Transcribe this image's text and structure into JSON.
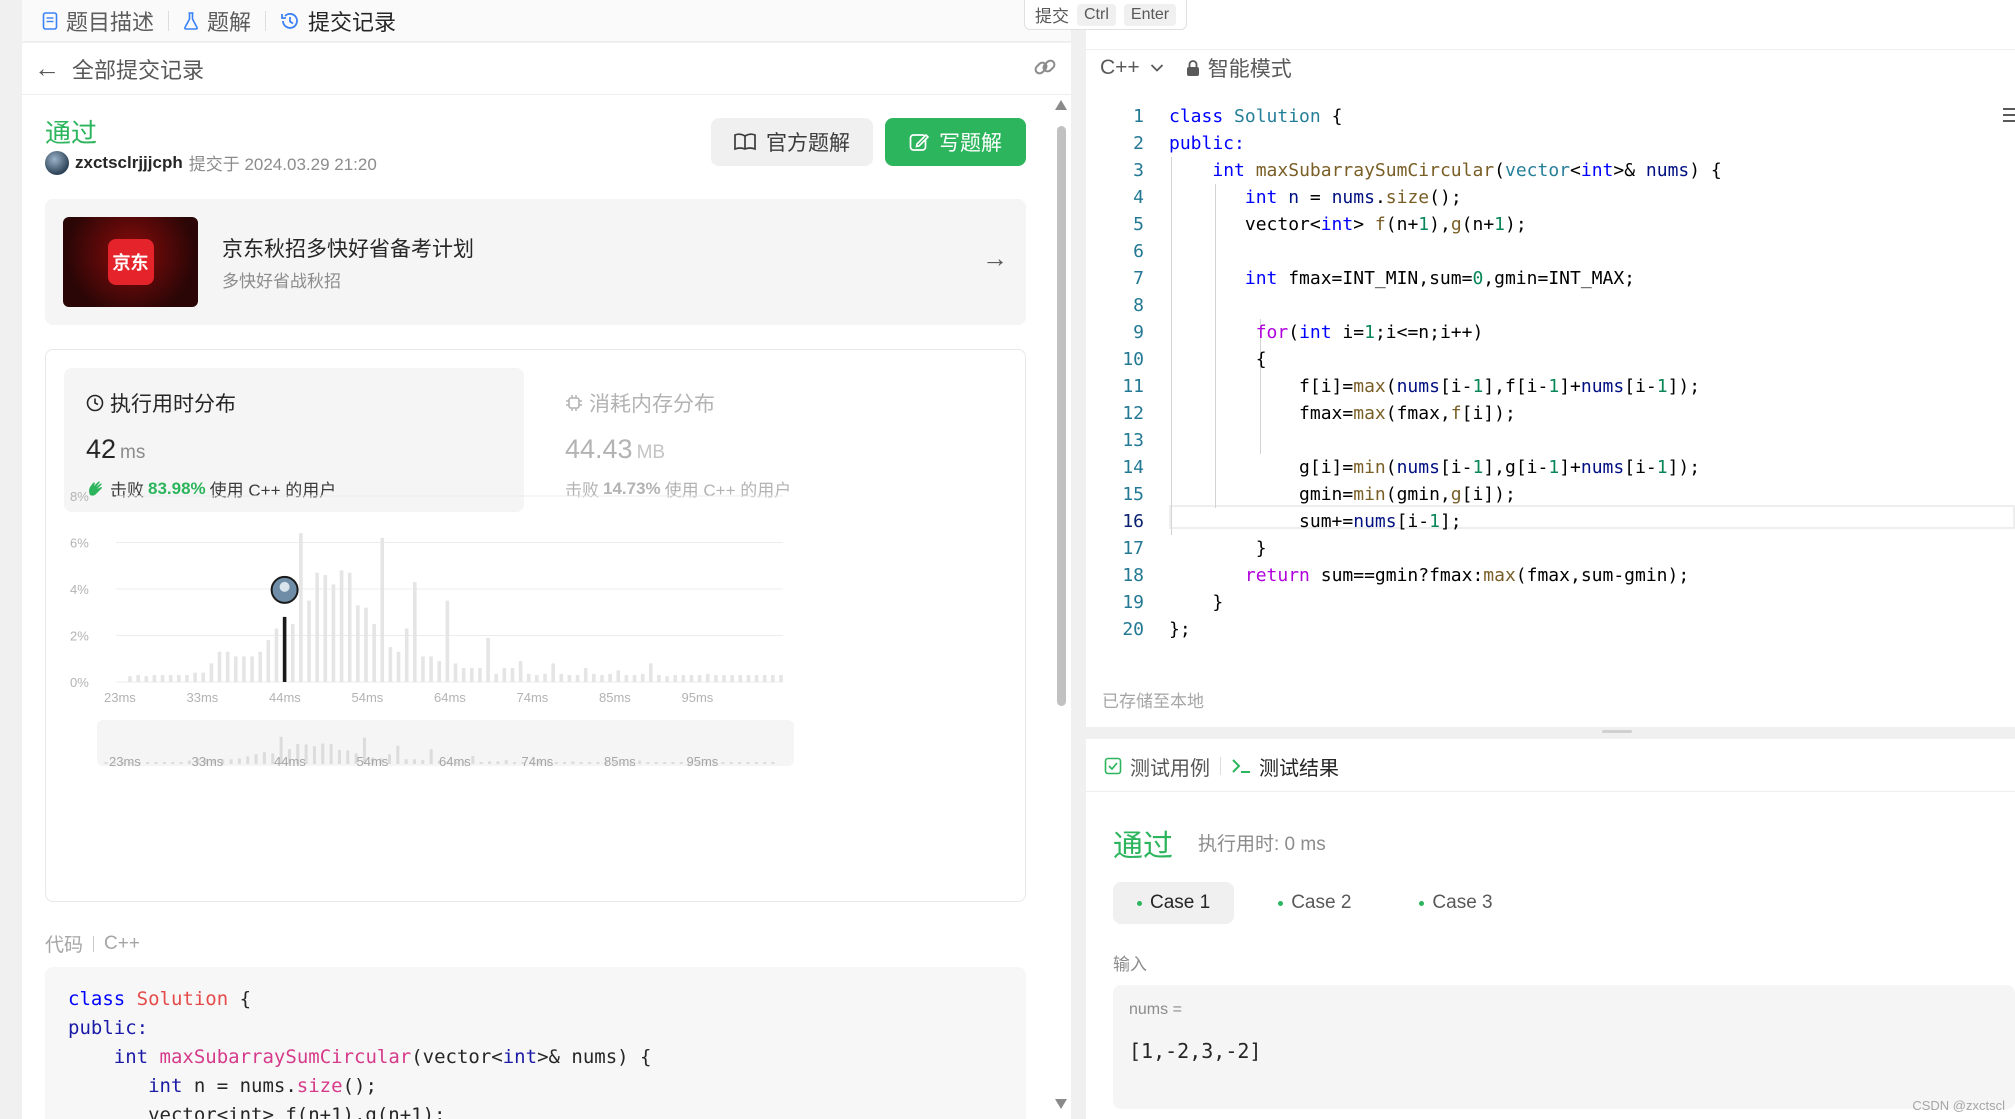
{
  "left_tabs": [
    {
      "label": "题目描述",
      "icon": "document-icon"
    },
    {
      "label": "题解",
      "icon": "flask-icon"
    },
    {
      "label": "提交记录",
      "icon": "history-icon"
    }
  ],
  "submissions": {
    "back_label": "全部提交记录",
    "status": "通过",
    "user": "zxctsclrjjjcph",
    "submitted_at": "提交于 2024.03.29 21:20",
    "official_solution_label": "官方题解",
    "write_solution_label": "写题解"
  },
  "ad": {
    "logo_text": "京东",
    "title": "京东秋招多快好省备考计划",
    "subtitle": "多快好省战秋招"
  },
  "perf": {
    "runtime": {
      "title": "执行用时分布",
      "value": "42",
      "unit": "ms",
      "beat_prefix": "击败",
      "beat_pct": "83.98%",
      "beat_suffix": "使用 C++ 的用户"
    },
    "memory": {
      "title": "消耗内存分布",
      "value": "44.43",
      "unit": "MB",
      "beat_prefix": "击败",
      "beat_pct": "14.73%",
      "beat_suffix": "使用 C++ 的用户"
    }
  },
  "chart_data": {
    "type": "bar",
    "title": "",
    "xlabel": "",
    "ylabel": "",
    "ylim": [
      0,
      8
    ],
    "y_ticks": [
      "0%",
      "2%",
      "4%",
      "6%",
      "8%"
    ],
    "x_tick_labels": [
      "23ms",
      "33ms",
      "44ms",
      "54ms",
      "64ms",
      "74ms",
      "85ms",
      "95ms"
    ],
    "x_start_ms": 23,
    "x_step_ms": 1,
    "highlight_ms": 42,
    "values": [
      0.25,
      0.3,
      0.25,
      0.3,
      0.3,
      0.3,
      0.3,
      0.3,
      0.4,
      0.4,
      0.8,
      1.3,
      1.3,
      1.1,
      1.1,
      1.1,
      1.3,
      1.8,
      2.3,
      2.8,
      2.5,
      6.4,
      3.5,
      4.7,
      4.6,
      4.2,
      4.8,
      4.7,
      3.3,
      3.2,
      2.5,
      6.2,
      1.5,
      1.3,
      2.3,
      4.3,
      1.1,
      1.1,
      0.9,
      3.5,
      0.8,
      0.6,
      0.6,
      0.6,
      1.9,
      0.35,
      0.6,
      0.6,
      0.9,
      0.35,
      0.3,
      0.35,
      0.8,
      0.35,
      0.3,
      0.3,
      0.6,
      0.35,
      0.3,
      0.35,
      0.5,
      0.3,
      0.3,
      0.35,
      0.8,
      0.3,
      0.25,
      0.3,
      0.3,
      0.3,
      0.3,
      0.35,
      0.3,
      0.3,
      0.3,
      0.3,
      0.3,
      0.3,
      0.3,
      0.3,
      0.3
    ]
  },
  "code_section": {
    "label": "代码",
    "lang": "C++",
    "lines": [
      [
        {
          "t": "class",
          "c": "kw"
        },
        {
          "t": " "
        },
        {
          "t": "Solution",
          "c": "cls"
        },
        {
          "t": " {"
        }
      ],
      [
        {
          "t": "public:",
          "c": "kwb"
        }
      ],
      [
        {
          "t": "    "
        },
        {
          "t": "int",
          "c": "kwb"
        },
        {
          "t": " "
        },
        {
          "t": "maxSubarraySumCircular",
          "c": "fn"
        },
        {
          "t": "(vector<"
        },
        {
          "t": "int",
          "c": "kwb"
        },
        {
          "t": ">& nums) {"
        }
      ],
      [
        {
          "t": "       "
        },
        {
          "t": "int",
          "c": "kwb"
        },
        {
          "t": " n = nums."
        },
        {
          "t": "size",
          "c": "fn"
        },
        {
          "t": "();"
        }
      ],
      [
        {
          "t": "       vector<int> f(n+1),g(n+1);"
        }
      ]
    ]
  },
  "editor": {
    "submit_label": "提交",
    "key1": "Ctrl",
    "key2": "Enter",
    "language": "C++",
    "mode": "智能模式",
    "saved_text": "已存储至本地",
    "current_line": 16,
    "lines": [
      [
        {
          "t": "class ",
          "c": "c-kw"
        },
        {
          "t": "Solution",
          "c": "c-ty"
        },
        {
          "t": " {"
        }
      ],
      [
        {
          "t": "public:",
          "c": "c-kw"
        }
      ],
      [
        {
          "t": "    "
        },
        {
          "t": "int",
          "c": "c-kw"
        },
        {
          "t": " "
        },
        {
          "t": "maxSubarraySumCircular",
          "c": "c-fn"
        },
        {
          "t": "("
        },
        {
          "t": "vector",
          "c": "c-ty"
        },
        {
          "t": "<"
        },
        {
          "t": "int",
          "c": "c-kw"
        },
        {
          "t": ">& "
        },
        {
          "t": "nums",
          "c": "c-var"
        },
        {
          "t": ") {"
        }
      ],
      [
        {
          "t": "       "
        },
        {
          "t": "int",
          "c": "c-kw"
        },
        {
          "t": " "
        },
        {
          "t": "n",
          "c": "c-var"
        },
        {
          "t": " = "
        },
        {
          "t": "nums",
          "c": "c-var"
        },
        {
          "t": "."
        },
        {
          "t": "size",
          "c": "c-fn"
        },
        {
          "t": "();"
        }
      ],
      [
        {
          "t": "       vector<"
        },
        {
          "t": "int",
          "c": "c-kw"
        },
        {
          "t": "> "
        },
        {
          "t": "f",
          "c": "c-fn"
        },
        {
          "t": "(n+"
        },
        {
          "t": "1",
          "c": "c-num"
        },
        {
          "t": "),"
        },
        {
          "t": "g",
          "c": "c-fn"
        },
        {
          "t": "(n+"
        },
        {
          "t": "1",
          "c": "c-num"
        },
        {
          "t": ");"
        }
      ],
      [],
      [
        {
          "t": "       "
        },
        {
          "t": "int",
          "c": "c-kw"
        },
        {
          "t": " fmax=INT_MIN,sum="
        },
        {
          "t": "0",
          "c": "c-num"
        },
        {
          "t": ",gmin=INT_MAX;"
        }
      ],
      [],
      [
        {
          "t": "        "
        },
        {
          "t": "for",
          "c": "c-kw2"
        },
        {
          "t": "("
        },
        {
          "t": "int",
          "c": "c-kw"
        },
        {
          "t": " i="
        },
        {
          "t": "1",
          "c": "c-num"
        },
        {
          "t": ";i<=n;i++)"
        }
      ],
      [
        {
          "t": "        {"
        }
      ],
      [
        {
          "t": "            f[i]="
        },
        {
          "t": "max",
          "c": "c-fn"
        },
        {
          "t": "("
        },
        {
          "t": "nums",
          "c": "c-var"
        },
        {
          "t": "[i-"
        },
        {
          "t": "1",
          "c": "c-num"
        },
        {
          "t": "],f[i-"
        },
        {
          "t": "1",
          "c": "c-num"
        },
        {
          "t": "]+"
        },
        {
          "t": "nums",
          "c": "c-var"
        },
        {
          "t": "[i-"
        },
        {
          "t": "1",
          "c": "c-num"
        },
        {
          "t": "]);"
        }
      ],
      [
        {
          "t": "            fmax="
        },
        {
          "t": "max",
          "c": "c-fn"
        },
        {
          "t": "(fmax,"
        },
        {
          "t": "f",
          "c": "c-fn"
        },
        {
          "t": "[i]);"
        }
      ],
      [],
      [
        {
          "t": "            g[i]="
        },
        {
          "t": "min",
          "c": "c-fn"
        },
        {
          "t": "("
        },
        {
          "t": "nums",
          "c": "c-var"
        },
        {
          "t": "[i-"
        },
        {
          "t": "1",
          "c": "c-num"
        },
        {
          "t": "],g[i-"
        },
        {
          "t": "1",
          "c": "c-num"
        },
        {
          "t": "]+"
        },
        {
          "t": "nums",
          "c": "c-var"
        },
        {
          "t": "[i-"
        },
        {
          "t": "1",
          "c": "c-num"
        },
        {
          "t": "]);"
        }
      ],
      [
        {
          "t": "            gmin="
        },
        {
          "t": "min",
          "c": "c-fn"
        },
        {
          "t": "(gmin,"
        },
        {
          "t": "g",
          "c": "c-fn"
        },
        {
          "t": "[i]);"
        }
      ],
      [
        {
          "t": "            sum+="
        },
        {
          "t": "nums",
          "c": "c-var"
        },
        {
          "t": "[i-"
        },
        {
          "t": "1",
          "c": "c-num"
        },
        {
          "t": "];"
        }
      ],
      [
        {
          "t": "        }"
        }
      ],
      [
        {
          "t": "       "
        },
        {
          "t": "return",
          "c": "c-kw2"
        },
        {
          "t": " sum==gmin?fmax:"
        },
        {
          "t": "max",
          "c": "c-fn"
        },
        {
          "t": "(fmax,sum-gmin);"
        }
      ],
      [
        {
          "t": "    }"
        }
      ],
      [
        {
          "t": "};"
        }
      ]
    ]
  },
  "test": {
    "tab_cases": "测试用例",
    "tab_result": "测试结果",
    "status": "通过",
    "runtime": "执行用时: 0 ms",
    "cases": [
      "Case 1",
      "Case 2",
      "Case 3"
    ],
    "input_label": "输入",
    "input_name": "nums =",
    "input_value": "[1,-2,3,-2]"
  },
  "watermark": "CSDN @zxctscl",
  "colors": {
    "accent_green": "#2db55d",
    "chart_bar": "#e5e5e5",
    "chart_highlight": "#1a1a1a"
  }
}
